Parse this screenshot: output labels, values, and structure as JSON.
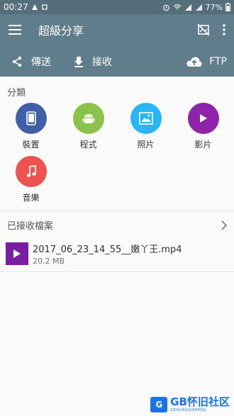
{
  "status": {
    "time": "00:27",
    "battery": "77%"
  },
  "app": {
    "title": "超級分享"
  },
  "actions": {
    "send": "傳送",
    "receive": "接收",
    "ftp": "FTP"
  },
  "categories_title": "分類",
  "categories": [
    {
      "label": "裝置",
      "color": "#3f5fa6",
      "icon": "phone-icon"
    },
    {
      "label": "程式",
      "color": "#8bc34a",
      "icon": "android-icon"
    },
    {
      "label": "照片",
      "color": "#29b6f6",
      "icon": "image-icon"
    },
    {
      "label": "影片",
      "color": "#8e24aa",
      "icon": "play-icon"
    },
    {
      "label": "音樂",
      "color": "#ef5350",
      "icon": "music-icon"
    }
  ],
  "received": {
    "title": "已接收檔案",
    "files": [
      {
        "name": "2017_06_23_14_55__嫩丫王.mp4",
        "size": "20.2 MB"
      }
    ]
  },
  "watermark": {
    "box": "G",
    "main": "GB怀旧社区",
    "sub": "GEHUAIJIUSHEQU"
  }
}
